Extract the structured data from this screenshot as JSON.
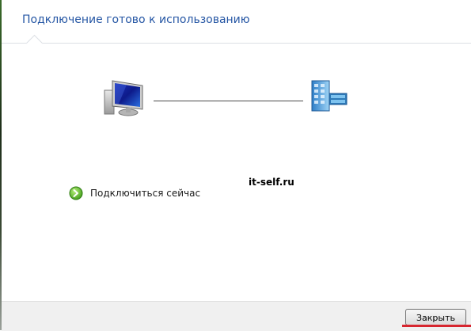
{
  "dialog": {
    "title": "Подключение готово к использованию"
  },
  "diagram": {
    "left_icon": "computer-icon",
    "right_icon": "server-network-icon"
  },
  "actions": {
    "connect_now_label": "Подключиться сейчас",
    "connect_icon": "green-arrow-icon"
  },
  "watermark": "it-self.ru",
  "footer": {
    "close_label": "Закрыть"
  },
  "colors": {
    "title": "#2556a4",
    "accent_underline": "#d7262f",
    "footer_bg": "#f0f0f0"
  }
}
